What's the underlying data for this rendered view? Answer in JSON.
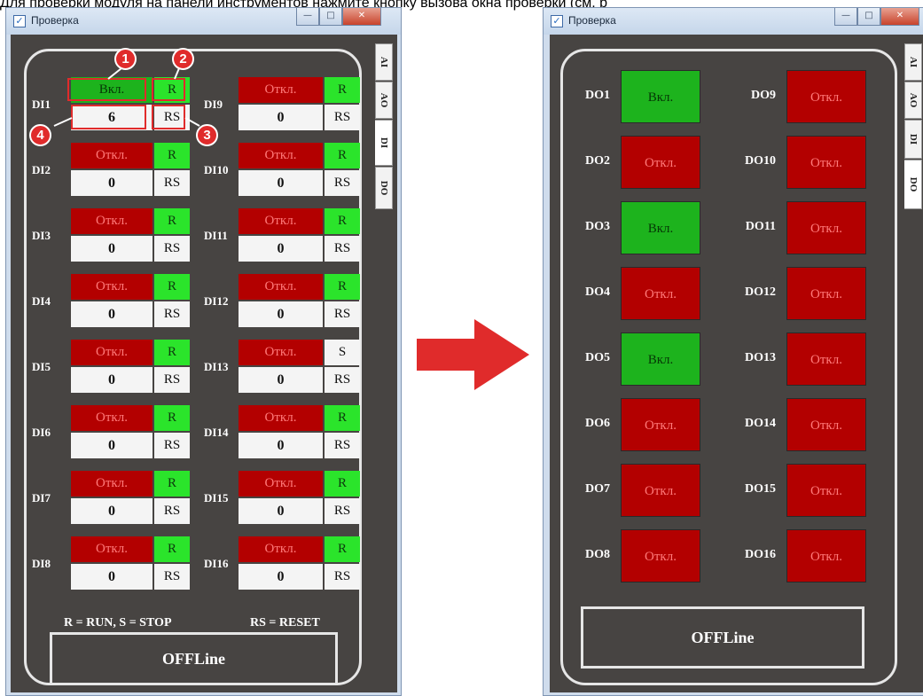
{
  "caption": "Для проверки модуля на панели инструментов нажмите кнопку вызова окна проверки (см. р",
  "window_title": "Проверка",
  "tabs": [
    "AI",
    "AO",
    "DI",
    "DO"
  ],
  "callouts": [
    "1",
    "2",
    "3",
    "4"
  ],
  "di_left": [
    {
      "label": "DI1",
      "state": "Вкл.",
      "on": true,
      "mode": "R",
      "count": "6",
      "reset": "RS"
    },
    {
      "label": "DI2",
      "state": "Откл.",
      "on": false,
      "mode": "R",
      "count": "0",
      "reset": "RS"
    },
    {
      "label": "DI3",
      "state": "Откл.",
      "on": false,
      "mode": "R",
      "count": "0",
      "reset": "RS"
    },
    {
      "label": "DI4",
      "state": "Откл.",
      "on": false,
      "mode": "R",
      "count": "0",
      "reset": "RS"
    },
    {
      "label": "DI5",
      "state": "Откл.",
      "on": false,
      "mode": "R",
      "count": "0",
      "reset": "RS"
    },
    {
      "label": "DI6",
      "state": "Откл.",
      "on": false,
      "mode": "R",
      "count": "0",
      "reset": "RS"
    },
    {
      "label": "DI7",
      "state": "Откл.",
      "on": false,
      "mode": "R",
      "count": "0",
      "reset": "RS"
    },
    {
      "label": "DI8",
      "state": "Откл.",
      "on": false,
      "mode": "R",
      "count": "0",
      "reset": "RS"
    }
  ],
  "di_right": [
    {
      "label": "DI9",
      "state": "Откл.",
      "on": false,
      "mode": "R",
      "count": "0",
      "reset": "RS"
    },
    {
      "label": "DI10",
      "state": "Откл.",
      "on": false,
      "mode": "R",
      "count": "0",
      "reset": "RS"
    },
    {
      "label": "DI11",
      "state": "Откл.",
      "on": false,
      "mode": "R",
      "count": "0",
      "reset": "RS"
    },
    {
      "label": "DI12",
      "state": "Откл.",
      "on": false,
      "mode": "R",
      "count": "0",
      "reset": "RS"
    },
    {
      "label": "DI13",
      "state": "Откл.",
      "on": false,
      "mode": "S",
      "count": "0",
      "reset": "RS"
    },
    {
      "label": "DI14",
      "state": "Откл.",
      "on": false,
      "mode": "R",
      "count": "0",
      "reset": "RS"
    },
    {
      "label": "DI15",
      "state": "Откл.",
      "on": false,
      "mode": "R",
      "count": "0",
      "reset": "RS"
    },
    {
      "label": "DI16",
      "state": "Откл.",
      "on": false,
      "mode": "R",
      "count": "0",
      "reset": "RS"
    }
  ],
  "legend_left": "R = RUN,   S = STOP",
  "legend_right": "RS = RESET",
  "offline_label": "OFFLine",
  "do_left": [
    {
      "label": "DO1",
      "state": "Вкл.",
      "on": true
    },
    {
      "label": "DO2",
      "state": "Откл.",
      "on": false
    },
    {
      "label": "DO3",
      "state": "Вкл.",
      "on": true
    },
    {
      "label": "DO4",
      "state": "Откл.",
      "on": false
    },
    {
      "label": "DO5",
      "state": "Вкл.",
      "on": true
    },
    {
      "label": "DO6",
      "state": "Откл.",
      "on": false
    },
    {
      "label": "DO7",
      "state": "Откл.",
      "on": false
    },
    {
      "label": "DO8",
      "state": "Откл.",
      "on": false
    }
  ],
  "do_right": [
    {
      "label": "DO9",
      "state": "Откл.",
      "on": false
    },
    {
      "label": "DO10",
      "state": "Откл.",
      "on": false
    },
    {
      "label": "DO11",
      "state": "Откл.",
      "on": false
    },
    {
      "label": "DO12",
      "state": "Откл.",
      "on": false
    },
    {
      "label": "DO13",
      "state": "Откл.",
      "on": false
    },
    {
      "label": "DO14",
      "state": "Откл.",
      "on": false
    },
    {
      "label": "DO15",
      "state": "Откл.",
      "on": false
    },
    {
      "label": "DO16",
      "state": "Откл.",
      "on": false
    }
  ],
  "colors": {
    "on": "#1db31d",
    "off": "#b30000",
    "run": "#2be42b",
    "callout": "#e02b2b",
    "arrow": "#e02b2b"
  }
}
